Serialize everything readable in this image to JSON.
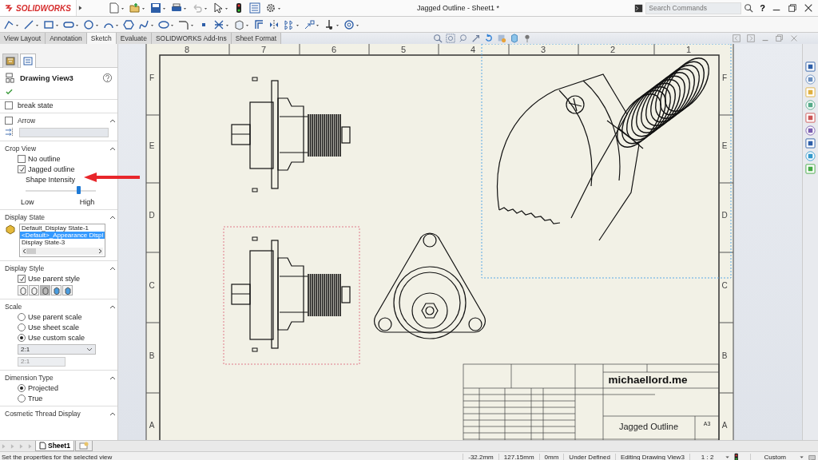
{
  "app": {
    "logo": "SOLIDWORKS",
    "title": "Jagged Outline - Sheet1 *",
    "search": {
      "placeholder": "Search Commands"
    },
    "help": "?"
  },
  "command_tabs": [
    {
      "label": "View Layout",
      "selected": false
    },
    {
      "label": "Annotation",
      "selected": false
    },
    {
      "label": "Sketch",
      "selected": true
    },
    {
      "label": "Evaluate",
      "selected": false
    },
    {
      "label": "SOLIDWORKS Add-Ins",
      "selected": false
    },
    {
      "label": "Sheet Format",
      "selected": false
    }
  ],
  "property_manager": {
    "tabs": [
      {
        "selected": false
      },
      {
        "selected": true
      }
    ],
    "title": "Drawing View3",
    "exploded": {
      "label": "break state",
      "checked": false
    },
    "arrow": {
      "label": "Arrow",
      "checked": false
    },
    "crop_view": {
      "title": "Crop View",
      "options": [
        {
          "label": "No outline",
          "checked": false
        },
        {
          "label": "Jagged outline",
          "checked": true
        }
      ],
      "intensity": {
        "label": "Shape Intensity",
        "level": 0.75,
        "min_label": "Low",
        "max_label": "High"
      }
    },
    "display_state": {
      "title": "Display State",
      "items": [
        {
          "label": "Default_Display State-1",
          "selected": false
        },
        {
          "label": "<Default>_Appearance Displ",
          "selected": true
        },
        {
          "label": "Display State-3",
          "selected": false
        }
      ]
    },
    "display_style": {
      "title": "Display Style",
      "use_parent": {
        "label": "Use parent style",
        "checked": true
      },
      "styles": [
        {
          "selected": false
        },
        {
          "selected": false
        },
        {
          "selected": true
        },
        {
          "selected": false
        },
        {
          "selected": false
        }
      ]
    },
    "scale": {
      "title": "Scale",
      "options": [
        {
          "label": "Use parent scale",
          "selected": false
        },
        {
          "label": "Use sheet scale",
          "selected": false
        },
        {
          "label": "Use custom scale",
          "selected": true
        }
      ],
      "dropdown": "2:1",
      "custom_value": "2:1"
    },
    "dimension_type": {
      "title": "Dimension Type",
      "options": [
        {
          "label": "Projected",
          "selected": true
        },
        {
          "label": "True",
          "selected": false
        }
      ]
    },
    "cosmetic_thread": {
      "title": "Cosmetic Thread Display"
    }
  },
  "sheet": {
    "column_labels": [
      "8",
      "7",
      "6",
      "5",
      "4",
      "3",
      "2",
      "1"
    ],
    "left_row_labels": [
      "F",
      "E",
      "D",
      "C",
      "B",
      "A"
    ],
    "right_row_labels": [
      "F",
      "E",
      "D",
      "C",
      "B",
      "A"
    ],
    "title_block": {
      "company": "michaellord.me",
      "title": "Jagged Outline",
      "size": "A3"
    }
  },
  "sheet_tabs": [
    {
      "label": "Sheet1",
      "selected": true
    }
  ],
  "status_bar": {
    "message": "Set the properties for the selected view",
    "x": "-32.2mm",
    "y": "127.15mm",
    "z": "0mm",
    "sketch_state": "Under Defined",
    "editing": "Editing Drawing View3",
    "scale": "1 : 2",
    "units": "Custom"
  }
}
